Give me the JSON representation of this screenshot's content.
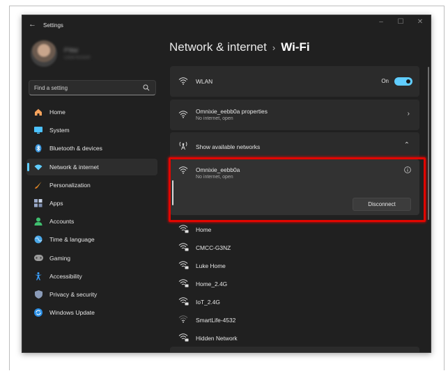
{
  "window": {
    "title": "Settings",
    "back_glyph": "←",
    "controls": [
      "–",
      "☐",
      "✕"
    ]
  },
  "profile": {
    "name": "P'Mal",
    "subtitle": "Local Account"
  },
  "search": {
    "placeholder": "Find a setting"
  },
  "sidebar": {
    "items": [
      {
        "label": "Home",
        "icon": "home-icon",
        "color": "#f7a35c"
      },
      {
        "label": "System",
        "icon": "system-icon",
        "color": "#4cc2ff"
      },
      {
        "label": "Bluetooth & devices",
        "icon": "bluetooth-icon",
        "color": "#3a96dd"
      },
      {
        "label": "Network & internet",
        "icon": "network-icon",
        "color": "#60cdff",
        "active": true
      },
      {
        "label": "Personalization",
        "icon": "brush-icon",
        "color": "#f0a030"
      },
      {
        "label": "Apps",
        "icon": "apps-icon",
        "color": "#9aa9c9"
      },
      {
        "label": "Accounts",
        "icon": "accounts-icon",
        "color": "#3fbf6f"
      },
      {
        "label": "Time & language",
        "icon": "time-language-icon",
        "color": "#4aa8e8"
      },
      {
        "label": "Gaming",
        "icon": "gaming-icon",
        "color": "#9a9a9a"
      },
      {
        "label": "Accessibility",
        "icon": "accessibility-icon",
        "color": "#3aa0ff"
      },
      {
        "label": "Privacy & security",
        "icon": "shield-icon",
        "color": "#8a9bb8"
      },
      {
        "label": "Windows Update",
        "icon": "update-icon",
        "color": "#2b8fe6"
      }
    ]
  },
  "breadcrumb": {
    "parent": "Network & internet",
    "separator": "›",
    "current": "Wi-Fi"
  },
  "wlan": {
    "label": "WLAN",
    "state": "On"
  },
  "properties": {
    "title": "Omnixie_eebb0a properties",
    "subtitle": "No internet, open"
  },
  "available": {
    "label": "Show available networks"
  },
  "connected": {
    "ssid": "Omnixie_eebb0a",
    "status": "No internet, open",
    "button": "Disconnect"
  },
  "networks": [
    {
      "ssid": "Home",
      "secured": true
    },
    {
      "ssid": "CMCC-G3NZ",
      "secured": true
    },
    {
      "ssid": "Luke Home",
      "secured": true
    },
    {
      "ssid": "Home_2.4G",
      "secured": true
    },
    {
      "ssid": "IoT_2.4G",
      "secured": true
    },
    {
      "ssid": "SmartLife-4532",
      "secured": false
    },
    {
      "ssid": "Hidden Network",
      "secured": true
    }
  ],
  "colors": {
    "accent": "#60cdff",
    "highlight": "#e10600",
    "background": "#202020",
    "card": "#2b2b2b"
  }
}
